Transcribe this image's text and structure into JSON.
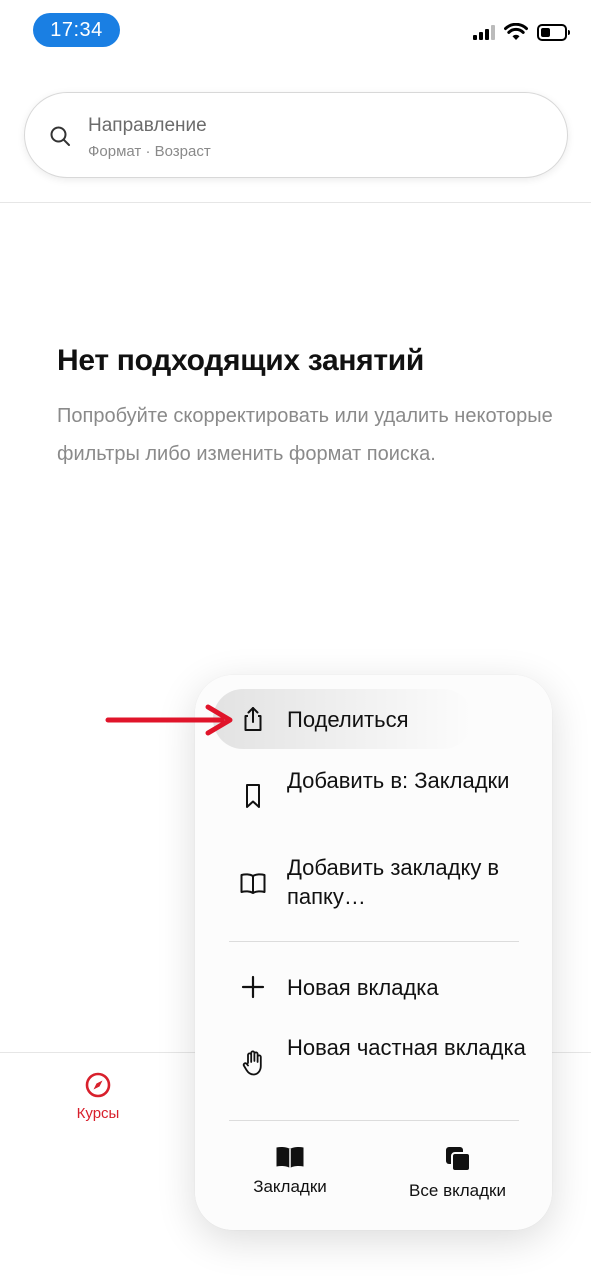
{
  "status_bar": {
    "time": "17:34",
    "icons": [
      "cellular-signal-icon",
      "wifi-icon",
      "battery-icon"
    ]
  },
  "search": {
    "title": "Направление",
    "subtitle": "Формат · Возраст",
    "icon": "search-icon"
  },
  "empty_state": {
    "title": "Нет подходящих занятий",
    "text": "Попробуйте скорректировать или удалить некоторые фильтры либо изменить формат поиска."
  },
  "bottom_nav": {
    "items": [
      {
        "label": "Курсы",
        "icon": "compass-icon",
        "active": true
      }
    ],
    "active_color": "#d8202c"
  },
  "context_menu": {
    "items": [
      {
        "label": "Поделиться",
        "icon": "share-icon"
      },
      {
        "label": "Добавить в: Закладки",
        "icon": "bookmark-icon"
      },
      {
        "label": "Добавить закладку в папку…",
        "icon": "book-icon"
      },
      {
        "label": "Новая вкладка",
        "icon": "plus-icon"
      },
      {
        "label": "Новая частная вкладка",
        "icon": "hand-icon"
      }
    ],
    "bottom_items": [
      {
        "label": "Закладки",
        "icon": "bookmarks-book-icon"
      },
      {
        "label": "Все вкладки",
        "icon": "all-tabs-icon"
      }
    ]
  },
  "colors": {
    "time_pill": "#1a7fe3",
    "annotation_arrow": "#e0142a",
    "accent": "#d8202c"
  }
}
